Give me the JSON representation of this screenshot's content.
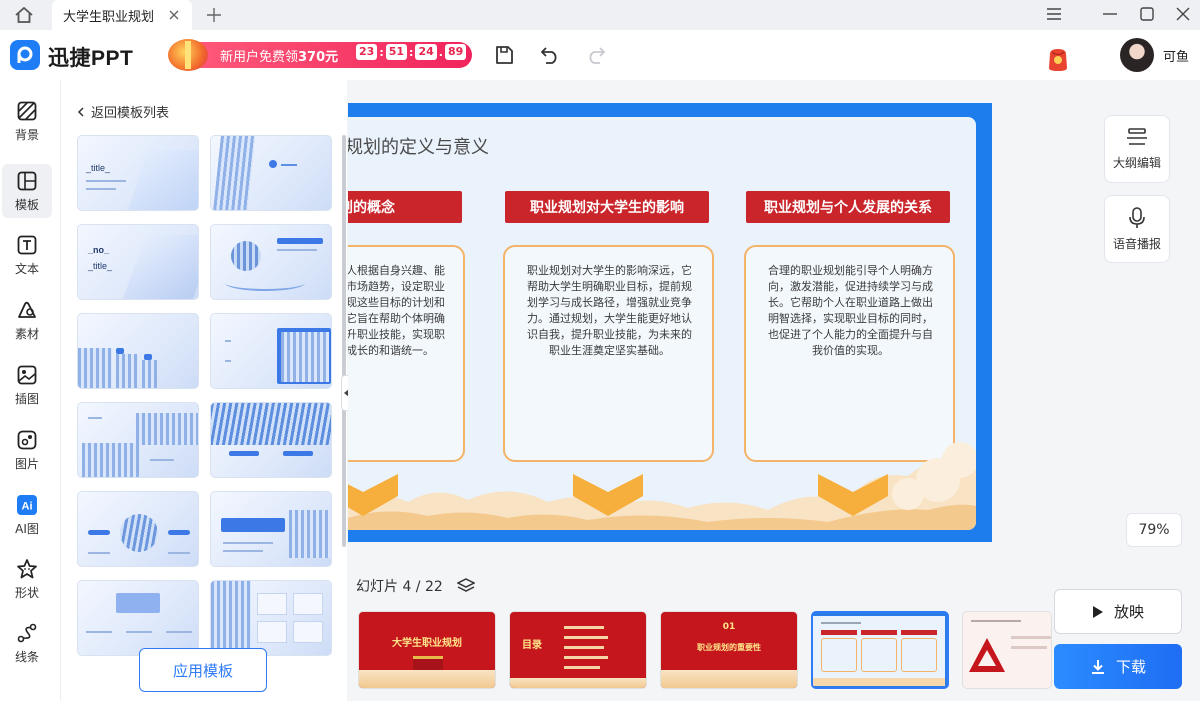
{
  "tabbar": {
    "doc_tab_title": "大学生职业规划"
  },
  "header": {
    "app_name": "迅捷PPT",
    "promo": {
      "text_prefix": "新用户免费领",
      "amount": "370元",
      "countdown": [
        "23",
        "51",
        "24",
        "89"
      ]
    },
    "user_name": "可鱼"
  },
  "toolbar": {
    "items": [
      {
        "label": "背景",
        "icon": "background-icon"
      },
      {
        "label": "模板",
        "icon": "template-icon"
      },
      {
        "label": "文本",
        "icon": "text-icon"
      },
      {
        "label": "素材",
        "icon": "material-icon"
      },
      {
        "label": "插图",
        "icon": "illustration-icon"
      },
      {
        "label": "图片",
        "icon": "image-icon"
      },
      {
        "label": "AI图",
        "icon": "ai-image-icon"
      },
      {
        "label": "形状",
        "icon": "shape-icon"
      },
      {
        "label": "线条",
        "icon": "line-icon"
      }
    ]
  },
  "panel": {
    "back_label": "返回模板列表",
    "apply_button": "应用模板",
    "thumb_labels": {
      "t1_title": "_title_",
      "t3_no": "_no_",
      "t3_title": "_title_"
    }
  },
  "slide": {
    "title": "规划的定义与意义",
    "columns": [
      {
        "header": "规划的概念",
        "text": "人根据自身兴趣、能市场趋势，设定职业现这些目标的计划和它旨在帮助个体明确升职业技能，实现职成长的和谐统一。"
      },
      {
        "header": "职业规划对大学生的影响",
        "text": "职业规划对大学生的影响深远，它帮助大学生明确职业目标，提前规划学习与成长路径，增强就业竞争力。通过规划，大学生能更好地认识自我，提升职业技能，为未来的职业生涯奠定坚实基础。"
      },
      {
        "header": "职业规划与个人发展的关系",
        "text": "合理的职业规划能引导个人明确方向，激发潜能，促进持续学习与成长。它帮助个人在职业道路上做出明智选择，实现职业目标的同时，也促进了个人能力的全面提升与自我价值的实现。"
      }
    ]
  },
  "side_tools": {
    "outline_label": "大纲编辑",
    "voice_label": "语音播报",
    "zoom": "79%"
  },
  "filmstrip": {
    "counter": "幻灯片 4 / 22",
    "slides": [
      {
        "title": "大学生职业规划"
      },
      {
        "title": "目录"
      },
      {
        "number": "01",
        "title": "职业规划的重要性"
      }
    ]
  },
  "actions": {
    "play": "放映",
    "download": "下载"
  },
  "colors": {
    "accent": "#2f7bf5",
    "slide_red": "#c9252b",
    "slide_border": "#1d7ded",
    "promo_pink": "#f0245c"
  }
}
